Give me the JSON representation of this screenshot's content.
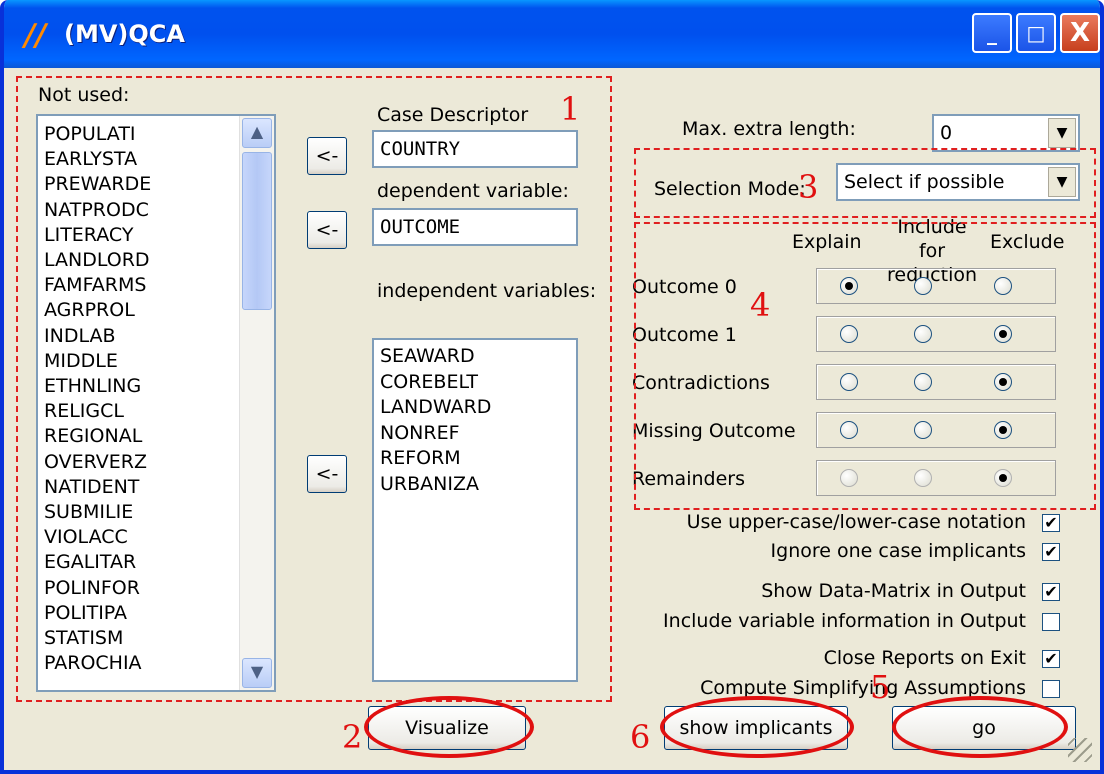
{
  "window": {
    "title": "(MV)QCA",
    "app_icon": "qca-logo-icon",
    "controls": {
      "minimize": "_",
      "maximize": "□",
      "close": "X"
    }
  },
  "left": {
    "not_used_label": "Not used:",
    "not_used_items": [
      "POPULATI",
      "EARLYSTA",
      "PREWARDE",
      "NATPRODC",
      "LITERACY",
      "LANDLORD",
      "FAMFARMS",
      "AGRPROL",
      "INDLAB",
      "MIDDLE",
      "ETHNLING",
      "RELIGCL",
      "REGIONAL",
      "OVERVERZ",
      "NATIDENT",
      "SUBMILIE",
      "VIOLACC",
      "EGALITAR",
      "POLINFOR",
      "POLITIPA",
      "STATISM",
      "PAROCHIA"
    ],
    "move_button_label": "<-",
    "case_descriptor_label": "Case Descriptor",
    "case_descriptor_value": "COUNTRY",
    "dependent_label": "dependent variable:",
    "dependent_value": "OUTCOME",
    "independent_label": "independent variables:",
    "independent_items": [
      "SEAWARD",
      "COREBELT",
      "LANDWARD",
      "NONREF",
      "REFORM",
      "URBANIZA"
    ],
    "visualize_label": "Visualize"
  },
  "right": {
    "max_extra_length_label": "Max. extra length:",
    "max_extra_length_value": "0",
    "selection_mode_label": "Selection Mode:",
    "selection_mode_value": "Select if possible",
    "columns": {
      "explain": "Explain",
      "include": "Include for reduction",
      "exclude": "Exclude"
    },
    "rows": [
      {
        "label": "Outcome 0",
        "selected": "explain"
      },
      {
        "label": "Outcome 1",
        "selected": "exclude"
      },
      {
        "label": "Contradictions",
        "selected": "exclude"
      },
      {
        "label": "Missing Outcome",
        "selected": "exclude"
      },
      {
        "label": "Remainders",
        "selected": "exclude"
      }
    ],
    "options": [
      {
        "label": "Use upper-case/lower-case notation",
        "checked": true
      },
      {
        "label": "Ignore one case implicants",
        "checked": true
      },
      {
        "label": "Show Data-Matrix in Output",
        "checked": true
      },
      {
        "label": "Include variable information in Output",
        "checked": false
      },
      {
        "label": "Close Reports on Exit",
        "checked": true
      },
      {
        "label": "Compute  Simplifying  Assumptions",
        "checked": false
      }
    ],
    "show_implicants_label": "show implicants",
    "go_label": "go"
  },
  "annotations": {
    "n1": "1",
    "n2": "2",
    "n3": "3",
    "n4": "4",
    "n5": "5",
    "n6": "6",
    "color": "#e01010"
  }
}
